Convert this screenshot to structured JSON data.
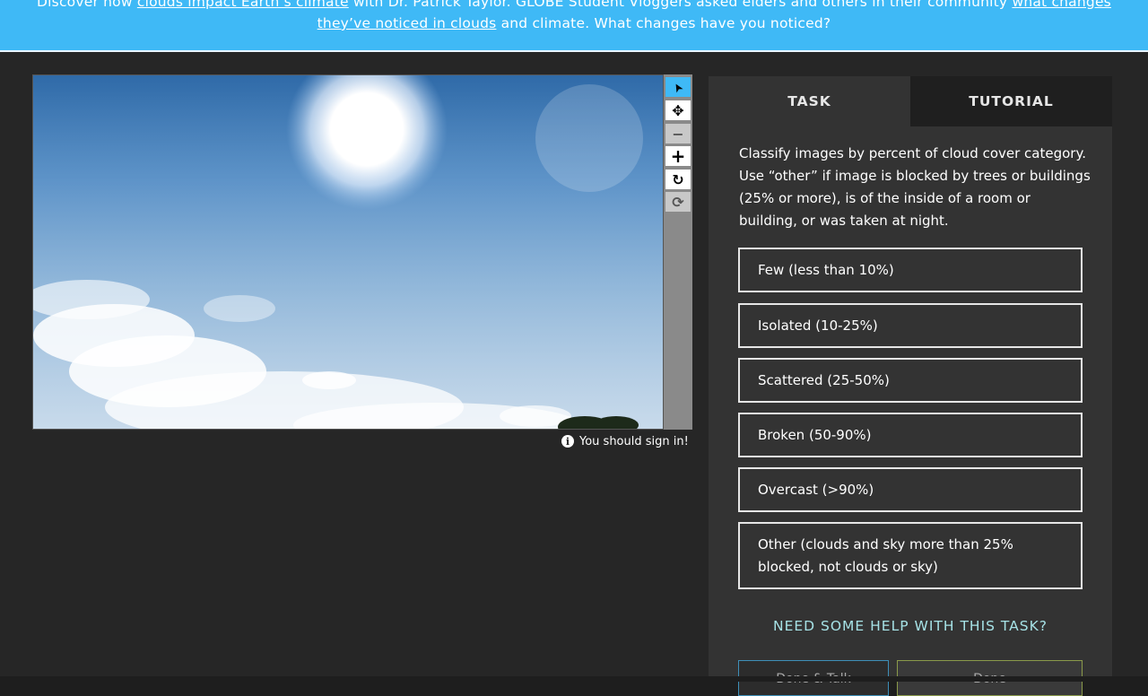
{
  "banner": {
    "part1": "Discover how ",
    "link1": "clouds impact Earth’s climate",
    "part2": " with Dr. Patrick Taylor. GLOBE Student Vloggers asked elders and others in their community ",
    "link2": "what changes they’ve noticed in clouds",
    "part3": " and climate. What changes have you noticed?"
  },
  "toolbar": {
    "tools": [
      {
        "name": "annotate",
        "icon": "cursor-arrow-icon",
        "glyph": "➤"
      },
      {
        "name": "move",
        "icon": "move-arrows-icon",
        "glyph": "✥"
      },
      {
        "name": "zoom-out",
        "icon": "minus-icon",
        "glyph": "−"
      },
      {
        "name": "zoom-in",
        "icon": "plus-icon",
        "glyph": "+"
      },
      {
        "name": "rotate",
        "icon": "rotate-icon",
        "glyph": "↻"
      },
      {
        "name": "reset",
        "icon": "refresh-icon",
        "glyph": "⟳"
      }
    ]
  },
  "signin_notice": "You should sign in!",
  "panel": {
    "tab_task": "TASK",
    "tab_tutorial": "TUTORIAL",
    "instructions": "Classify images by percent of cloud cover category. Use “other” if image is blocked by trees or buildings (25% or more), is of the inside of a room or building, or was taken at night.",
    "answers": [
      "Few (less than 10%)",
      "Isolated (10-25%)",
      "Scattered (25-50%)",
      "Broken (50-90%)",
      "Overcast (>90%)",
      "Other (clouds and sky more than 25% blocked, not clouds or sky)"
    ],
    "help": "NEED SOME HELP WITH THIS TASK?",
    "done_talk": "Done & Talk",
    "done": "Done"
  },
  "colors": {
    "banner": "#3fb9f6",
    "page_bg": "#262626",
    "panel_bg": "#333333",
    "help_text": "#a6e2e6"
  }
}
